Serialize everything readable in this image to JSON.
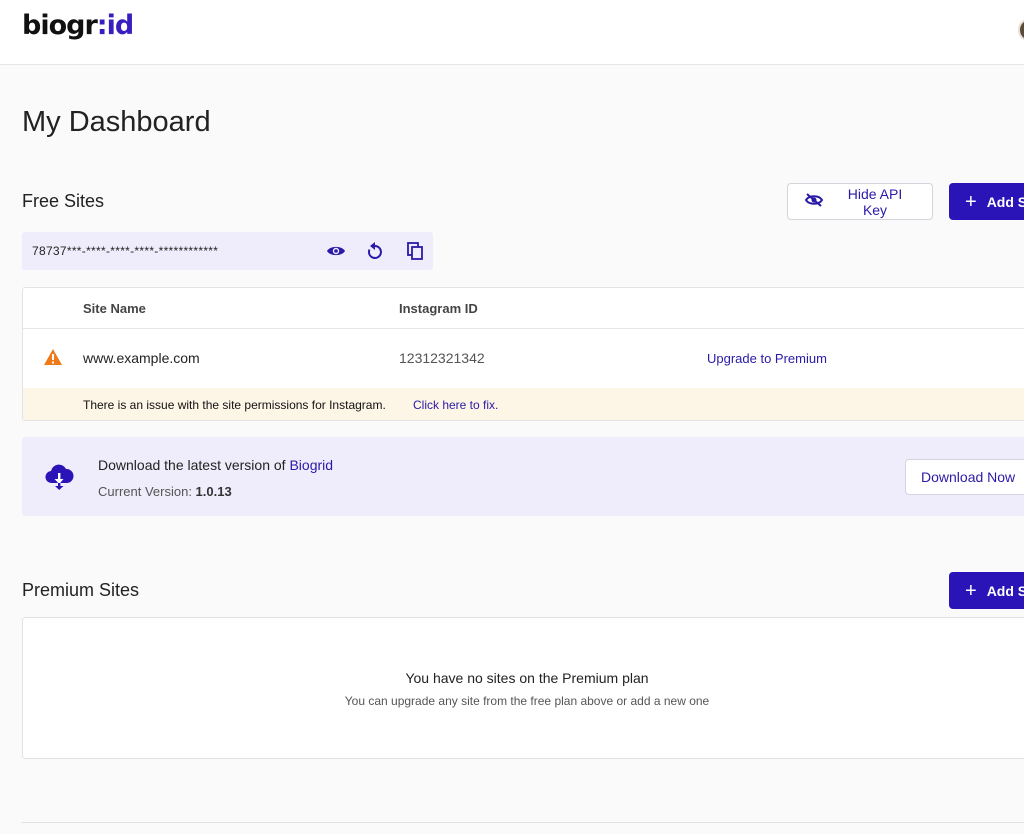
{
  "header": {
    "logo_main": "biogr",
    "logo_colon": ":",
    "logo_accent": "id"
  },
  "page": {
    "title": "My Dashboard"
  },
  "free_sites": {
    "title": "Free Sites",
    "hide_api_label": "Hide API Key",
    "add_site_label": "Add Site",
    "api_key_masked": "78737***-****-****-****-************",
    "table": {
      "columns": [
        "Site Name",
        "Instagram ID"
      ],
      "rows": [
        {
          "site_name": "www.example.com",
          "instagram_id": "12312321342",
          "action": "Upgrade to Premium",
          "warning": "There is an issue with the site permissions for Instagram.",
          "warning_link": "Click here to fix."
        }
      ]
    }
  },
  "download": {
    "title_prefix": "Download the latest version of ",
    "brand": "Biogrid",
    "version_label": "Current Version: ",
    "version_value": "1.0.13",
    "button_label": "Download Now"
  },
  "premium_sites": {
    "title": "Premium Sites",
    "add_site_label": "Add Site",
    "empty_title": "You have no sites on the Premium plan",
    "empty_subtitle": "You can upgrade any site from the free plan above or add a new one"
  },
  "colors": {
    "brand": "#2a14b8",
    "warning": "#f07a1a",
    "accent_bg": "#efedfb"
  }
}
